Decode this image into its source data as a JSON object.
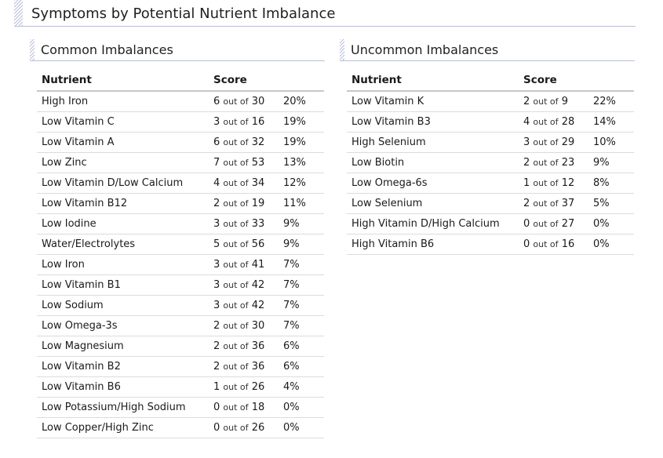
{
  "page": {
    "title": "Symptoms by Potential Nutrient Imbalance"
  },
  "colors": {
    "accent_line": "#b7bfe0",
    "row_divider": "#dcdcdc",
    "header_divider": "#c8c8c8",
    "text": "#1a1a1a"
  },
  "common": {
    "title": "Common Imbalances",
    "columns": {
      "nutrient": "Nutrient",
      "score": "Score"
    },
    "out_of_label": "out of",
    "rows": [
      {
        "nutrient": "High Iron",
        "score": "6",
        "total": "30",
        "percent": "20%"
      },
      {
        "nutrient": "Low Vitamin C",
        "score": "3",
        "total": "16",
        "percent": "19%"
      },
      {
        "nutrient": "Low Vitamin A",
        "score": "6",
        "total": "32",
        "percent": "19%"
      },
      {
        "nutrient": "Low Zinc",
        "score": "7",
        "total": "53",
        "percent": "13%"
      },
      {
        "nutrient": "Low Vitamin D/Low Calcium",
        "score": "4",
        "total": "34",
        "percent": "12%"
      },
      {
        "nutrient": "Low Vitamin B12",
        "score": "2",
        "total": "19",
        "percent": "11%"
      },
      {
        "nutrient": "Low Iodine",
        "score": "3",
        "total": "33",
        "percent": "9%"
      },
      {
        "nutrient": "Water/Electrolytes",
        "score": "5",
        "total": "56",
        "percent": "9%"
      },
      {
        "nutrient": "Low Iron",
        "score": "3",
        "total": "41",
        "percent": "7%"
      },
      {
        "nutrient": "Low Vitamin B1",
        "score": "3",
        "total": "42",
        "percent": "7%"
      },
      {
        "nutrient": "Low Sodium",
        "score": "3",
        "total": "42",
        "percent": "7%"
      },
      {
        "nutrient": "Low Omega-3s",
        "score": "2",
        "total": "30",
        "percent": "7%"
      },
      {
        "nutrient": "Low Magnesium",
        "score": "2",
        "total": "36",
        "percent": "6%"
      },
      {
        "nutrient": "Low Vitamin B2",
        "score": "2",
        "total": "36",
        "percent": "6%"
      },
      {
        "nutrient": "Low Vitamin B6",
        "score": "1",
        "total": "26",
        "percent": "4%"
      },
      {
        "nutrient": "Low Potassium/High Sodium",
        "score": "0",
        "total": "18",
        "percent": "0%"
      },
      {
        "nutrient": "Low Copper/High Zinc",
        "score": "0",
        "total": "26",
        "percent": "0%"
      }
    ]
  },
  "uncommon": {
    "title": "Uncommon Imbalances",
    "columns": {
      "nutrient": "Nutrient",
      "score": "Score"
    },
    "out_of_label": "out of",
    "rows": [
      {
        "nutrient": "Low Vitamin K",
        "score": "2",
        "total": "9",
        "percent": "22%"
      },
      {
        "nutrient": "Low Vitamin B3",
        "score": "4",
        "total": "28",
        "percent": "14%"
      },
      {
        "nutrient": "High Selenium",
        "score": "3",
        "total": "29",
        "percent": "10%"
      },
      {
        "nutrient": "Low Biotin",
        "score": "2",
        "total": "23",
        "percent": "9%"
      },
      {
        "nutrient": "Low Omega-6s",
        "score": "1",
        "total": "12",
        "percent": "8%"
      },
      {
        "nutrient": "Low Selenium",
        "score": "2",
        "total": "37",
        "percent": "5%"
      },
      {
        "nutrient": "High Vitamin D/High Calcium",
        "score": "0",
        "total": "27",
        "percent": "0%"
      },
      {
        "nutrient": "High Vitamin B6",
        "score": "0",
        "total": "16",
        "percent": "0%"
      }
    ]
  }
}
